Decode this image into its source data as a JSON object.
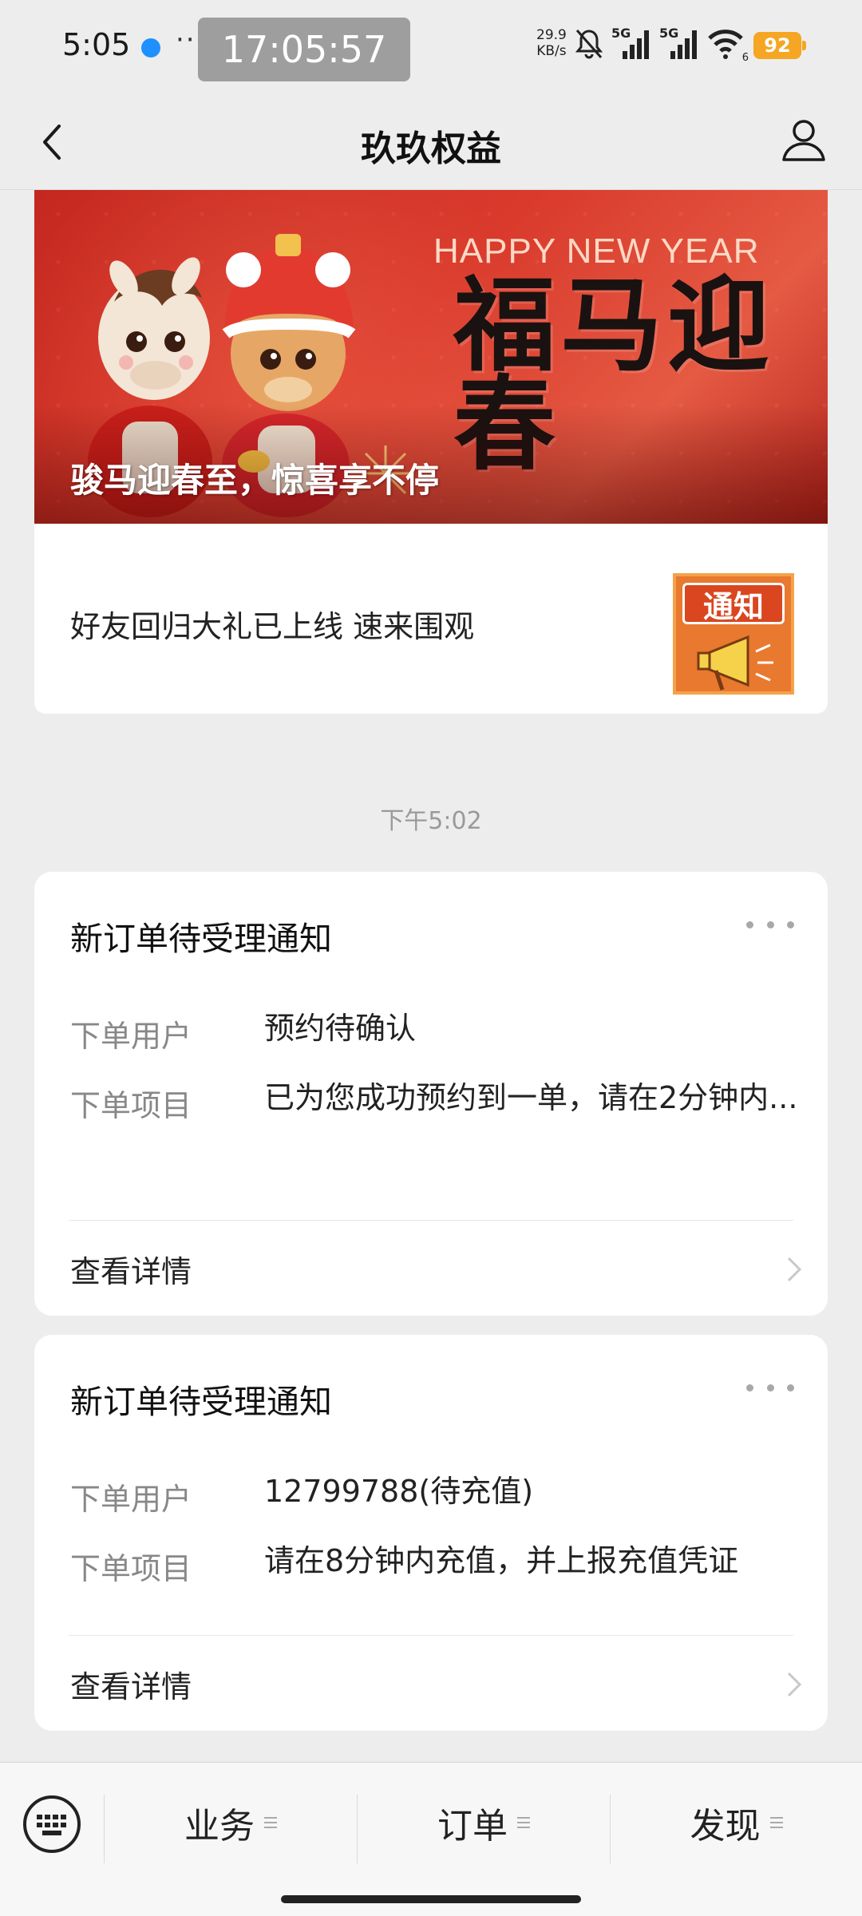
{
  "status_bar": {
    "time": "5:05",
    "more": "···",
    "clock": "17:05:57",
    "net_speed_value": "29.9",
    "net_speed_unit": "KB/s",
    "signal1_label": "5G",
    "signal2_label": "5G",
    "wifi_sub": "6",
    "battery": "92"
  },
  "nav": {
    "title": "玖玖权益"
  },
  "banner": {
    "headline_en": "HAPPY NEW YEAR",
    "headline_cn": "福马迎春",
    "caption": "骏马迎春至，惊喜享不停"
  },
  "notice": {
    "text": "好友回归大礼已上线 速来围观",
    "thumb_label": "通知"
  },
  "timestamp": "下午5:02",
  "messages": [
    {
      "title": "新订单待受理通知",
      "fields": [
        {
          "label": "下单用户",
          "value": "预约待确认"
        },
        {
          "label": "下单项目",
          "value": "已为您成功预约到一单，请在2分钟内..."
        }
      ],
      "link": "查看详情"
    },
    {
      "title": "新订单待受理通知",
      "fields": [
        {
          "label": "下单用户",
          "value": "12799788(待充值)"
        },
        {
          "label": "下单项目",
          "value": "请在8分钟内充值，并上报充值凭证"
        }
      ],
      "link": "查看详情"
    }
  ],
  "bottom_menu": {
    "items": [
      {
        "label": "业务"
      },
      {
        "label": "订单"
      },
      {
        "label": "发现"
      }
    ]
  },
  "colors": {
    "banner_red": "#c4281f",
    "page_bg": "#ededed",
    "battery": "#f5a623"
  }
}
